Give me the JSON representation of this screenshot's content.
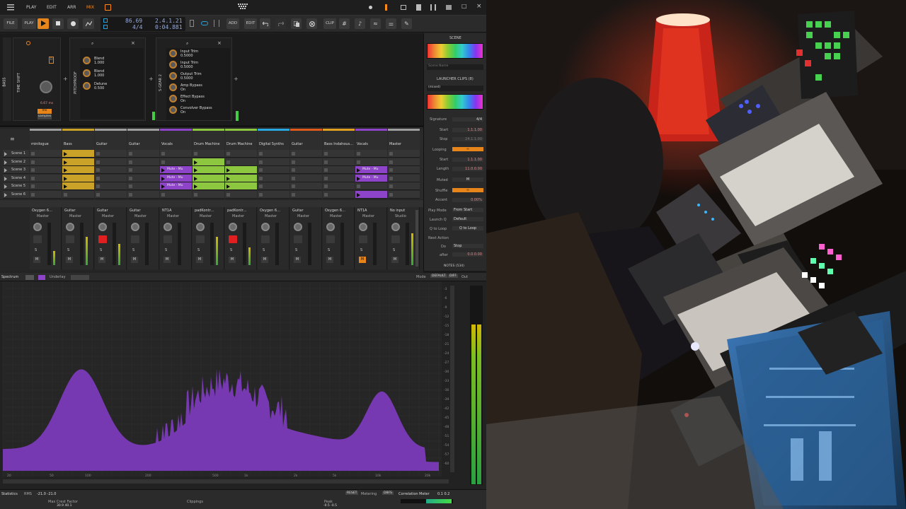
{
  "topbar": {
    "menu": [
      "PLAY",
      "EDIT",
      "ARR",
      "MIX"
    ],
    "window_buttons": [
      "−",
      "□",
      "×"
    ]
  },
  "toolbar": {
    "file": "FILE",
    "play": "PLAY",
    "tempo": "86.69",
    "signature": "4/4",
    "position_bars": "2.4.1.21",
    "position_time": "0:04.881",
    "add": "ADD",
    "edit": "EDIT",
    "clip": "CLIP"
  },
  "devices": {
    "track_label": "BASS",
    "time_shift": "TIME SHIFT",
    "time_shift_value": "6.67 ms",
    "ms": "ms",
    "samples": "samples",
    "pitchproof": "PITCHPROOF",
    "pitch_params": [
      {
        "name": "Blend",
        "value": "1.000"
      },
      {
        "name": "Blend",
        "value": "1.000"
      },
      {
        "name": "Detune",
        "value": "0.500"
      }
    ],
    "sgear": "S-GEAR 2",
    "sgear_params": [
      {
        "name": "Input Trim",
        "value": "0.5000"
      },
      {
        "name": "Input Trim",
        "value": "0.5000"
      },
      {
        "name": "Output Trim",
        "value": "0.5000"
      },
      {
        "name": "Amp Bypass",
        "value": "On"
      },
      {
        "name": "Effect Bypass",
        "value": "On"
      },
      {
        "name": "Convolver Bypass",
        "value": "On"
      }
    ]
  },
  "launcher": {
    "tracks": [
      "minilogue",
      "Bass",
      "Guitar",
      "Guitar",
      "Vocals",
      "Drum Machine",
      "Drum Machine",
      "Digital Synths",
      "Guitar",
      "Bass Indahous…",
      "Vocals",
      "Master"
    ],
    "track_colors": [
      "#9e9e9e",
      "#c9a227",
      "#9e9e9e",
      "#9e9e9e",
      "#8e44c8",
      "#8dc63f",
      "#8dc63f",
      "#28a8e0",
      "#e05a1c",
      "#e0a020",
      "#8e44c8",
      "#9e9e9e"
    ],
    "scenes": [
      "Scene 1",
      "Scene 2",
      "Scene 3",
      "Scene 4",
      "Scene 5",
      "Scene 6"
    ],
    "muted_clip": "Mute - Mu"
  },
  "mixer": {
    "strips": [
      {
        "name": "Oxygen 6…",
        "out": "Master"
      },
      {
        "name": "Guitar",
        "out": "Master"
      },
      {
        "name": "Guitar",
        "out": "Master"
      },
      {
        "name": "Guitar",
        "out": "Master"
      },
      {
        "name": "NT1A",
        "out": "Master"
      },
      {
        "name": "padKontr…",
        "out": "Master"
      },
      {
        "name": "padKontr…",
        "out": "Master"
      },
      {
        "name": "Oxygen 6…",
        "out": "Master"
      },
      {
        "name": "Guitar",
        "out": "Master"
      },
      {
        "name": "Oxygen 6…",
        "out": "Master"
      },
      {
        "name": "NT1A",
        "out": "Master"
      },
      {
        "name": "No input",
        "out": "Studio"
      }
    ],
    "s": "S",
    "m": "M"
  },
  "scene_panel": {
    "title": "SCENE",
    "scene_name": "Scene Name",
    "launcher_clips": "LAUNCHER CLIPS (8)",
    "mixed": "(mixed)",
    "rows": [
      {
        "label": "Signature",
        "value": "4/4"
      },
      {
        "label": "Start",
        "value": "1.1.1.00"
      },
      {
        "label": "Stop",
        "value": "24.1.1.00"
      },
      {
        "label": "Looping",
        "value": "∞"
      },
      {
        "label": "Start",
        "value": "1.1.1.00"
      },
      {
        "label": "Length",
        "value": "11.0.0.00"
      },
      {
        "label": "Muted",
        "value": "M"
      },
      {
        "label": "Shuffle",
        "value": "∞"
      },
      {
        "label": "Accent",
        "value": "0.00%"
      },
      {
        "label": "Play Mode",
        "value": "From Start"
      },
      {
        "label": "Launch Q",
        "value": "Default"
      },
      {
        "label": "Q to Loop",
        "value": "Q to Loop"
      },
      {
        "label": "Next Action",
        "value": ""
      },
      {
        "label": "Do",
        "value": "Stop"
      },
      {
        "label": "after",
        "value": "0.0.0.00"
      }
    ],
    "notes": "NOTES (534)"
  },
  "spectrum": {
    "title": "Spectrum",
    "underlay": "Underlay",
    "mode": "Mode",
    "default": "DEFAULT",
    "diff": "DIFF",
    "out": "Out",
    "statistics": "Statistics",
    "rms": "RMS",
    "rms_value": "-21.0 -21.0",
    "max_crest_label": "Max Crest Factor",
    "max_crest_value": "30.9 40.1",
    "clippings": "Clippings",
    "peak": "Peak",
    "peak_value": "-0.5 -0.5",
    "reset": "RESET",
    "metering": "Metering",
    "dbfs": "DBFS",
    "correlation": "Correlation Meter",
    "corr_values": "0.1 0.2",
    "db_ticks": [
      "-3",
      "-6",
      "-9",
      "-12",
      "-15",
      "-18",
      "-21",
      "-24",
      "-27",
      "-30",
      "-33",
      "-36",
      "-39",
      "-42",
      "-45",
      "-48",
      "-51",
      "-54",
      "-57",
      "-60"
    ],
    "freq_ticks": [
      "20",
      "50",
      "100",
      "200",
      "500",
      "1k",
      "2k",
      "5k",
      "10k",
      "20k"
    ]
  }
}
